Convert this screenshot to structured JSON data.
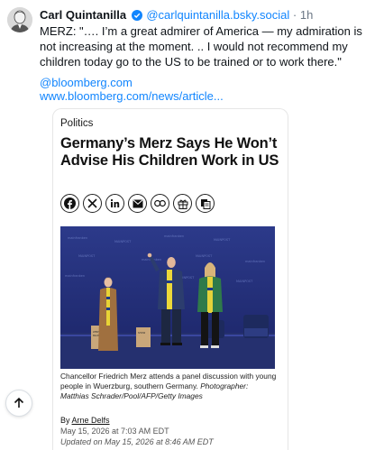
{
  "post": {
    "author_name": "Carl Quintanilla",
    "handle": "@carlquintanilla.bsky.social",
    "separator": "·",
    "time": "1h",
    "text": "MERZ: \"…. I’m a great admirer of America — my admiration is not increasing at the moment. .. I would not recommend my children today go to the US to be trained or to work there.\"",
    "link_mention": "@bloomberg.com",
    "link_url": "www.bloomberg.com/news/article..."
  },
  "article": {
    "section": "Politics",
    "headline": "Germany’s Merz Says He Won’t Advise His Children Work in US",
    "share_icons": [
      "facebook-icon",
      "x-icon",
      "linkedin-icon",
      "email-icon",
      "link-icon",
      "gift-icon",
      "copy-icon"
    ],
    "caption_text": "Chancellor Friedrich Merz attends a panel discussion with young people in Wuerzburg, southern Germany. ",
    "caption_credit": "Photographer: Matthias Schrader/Pool/AFP/Getty Images",
    "byline_prefix": "By ",
    "byline_author": "Arne Delfs",
    "published": "May 15, 2026 at 7:03 AM EDT",
    "updated": "Updated on May 15, 2026 at 8:46 AM EDT"
  },
  "colors": {
    "link_blue": "#1185fe",
    "text": "#0f1419",
    "muted": "#6b7785"
  }
}
